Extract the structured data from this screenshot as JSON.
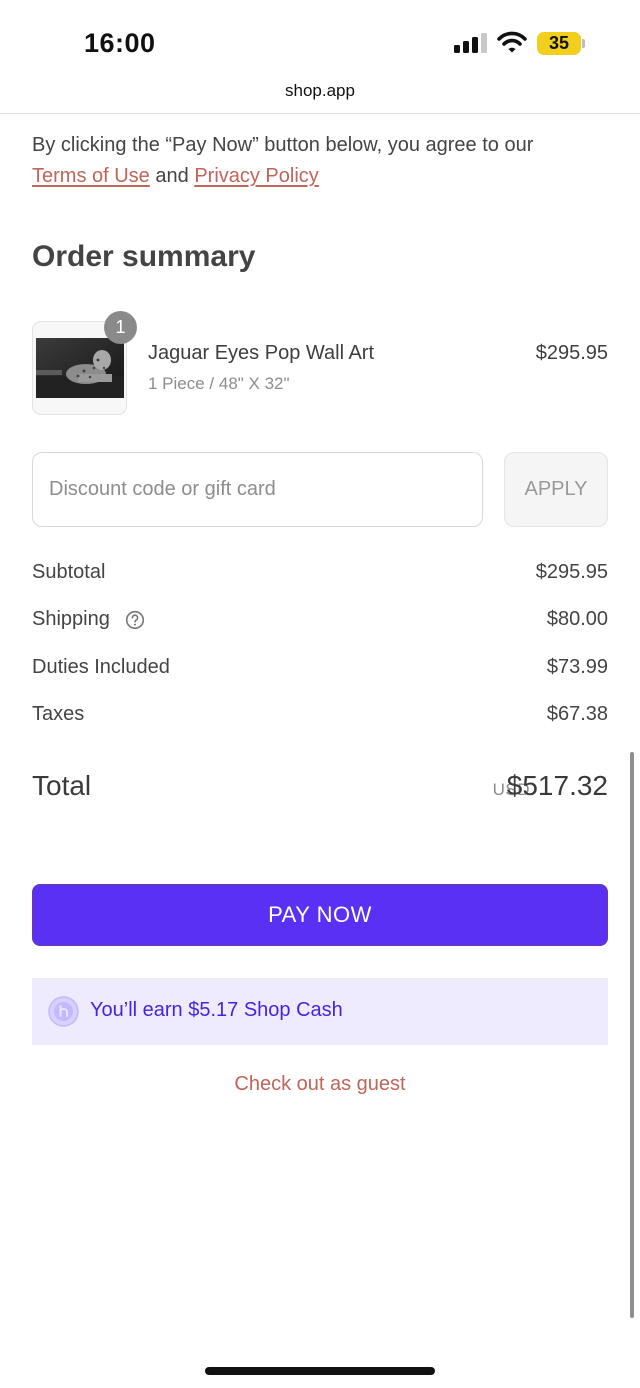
{
  "status_bar": {
    "time": "16:00",
    "battery": "35",
    "signal_icon": "cellular-signal-icon",
    "wifi_icon": "wifi-icon",
    "battery_color": "#f2cf1d"
  },
  "browser": {
    "url": "shop.app"
  },
  "legal": {
    "prefix": "By clicking the “Pay Now” button below, you agree to our",
    "terms_label": "Terms of Use",
    "and": "and",
    "privacy_label": "Privacy Policy"
  },
  "order": {
    "title": "Order summary",
    "item": {
      "quantity": "1",
      "name": "Jaguar Eyes Pop Wall Art",
      "variant": "1 Piece / 48\" X 32\"",
      "price": "$295.95"
    }
  },
  "discount": {
    "placeholder": "Discount code or gift card",
    "value": "",
    "apply_label": "APPLY"
  },
  "summary": {
    "rows": [
      {
        "label": "Subtotal",
        "value": "$295.95"
      },
      {
        "label": "Shipping",
        "value": "$80.00"
      },
      {
        "label": "Duties Included",
        "value": "$73.99"
      },
      {
        "label": "Taxes",
        "value": "$67.38"
      }
    ],
    "total_label": "Total",
    "currency": "USD",
    "total_value": "$517.32"
  },
  "actions": {
    "pay_label": "PAY NOW",
    "pay_color": "#5a31f4",
    "shop_cash_text": "You’ll earn $5.17 Shop Cash",
    "guest_label": "Check out as guest",
    "link_color": "#c0655a"
  }
}
